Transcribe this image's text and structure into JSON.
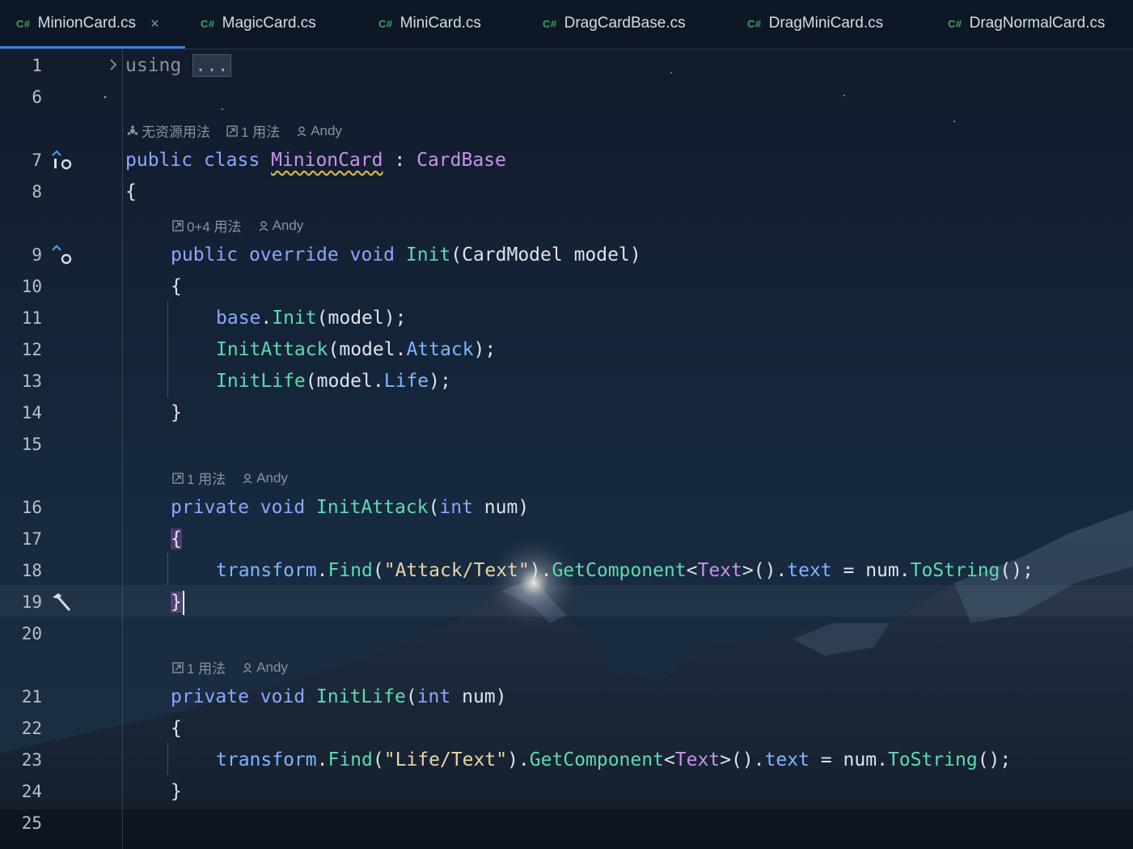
{
  "tabs": [
    {
      "lang": "C#",
      "label": "MinionCard.cs",
      "active": true,
      "closable": true,
      "close": "×"
    },
    {
      "lang": "C#",
      "label": "MagicCard.cs"
    },
    {
      "lang": "C#",
      "label": "MiniCard.cs"
    },
    {
      "lang": "C#",
      "label": "DragCardBase.cs"
    },
    {
      "lang": "C#",
      "label": "DragMiniCard.cs"
    },
    {
      "lang": "C#",
      "label": "DragNormalCard.cs"
    }
  ],
  "hints": {
    "class": {
      "no_asset": "无资源用法",
      "usages": "1 用法",
      "author": "Andy"
    },
    "init": {
      "usages": "0+4 用法",
      "author": "Andy"
    },
    "initattack": {
      "usages": "1 用法",
      "author": "Andy"
    },
    "initlife": {
      "usages": "1 用法",
      "author": "Andy"
    }
  },
  "line_numbers": [
    "1",
    "6",
    "7",
    "8",
    "9",
    "10",
    "11",
    "12",
    "13",
    "14",
    "15",
    "16",
    "17",
    "18",
    "19",
    "20",
    "21",
    "22",
    "23",
    "24",
    "25"
  ],
  "code": {
    "l1_using": "using",
    "l1_fold": "...",
    "public": "public",
    "class": "class",
    "class_name": "MinionCard",
    "colon": " : ",
    "base_class": "CardBase",
    "open": "{",
    "close": "}",
    "override": "override",
    "void": "void",
    "init": "Init",
    "cardmodel": "CardModel",
    "model": "model",
    "base": "base",
    "init_attack": "InitAttack",
    "init_life": "InitLife",
    "attack": "Attack",
    "life": "Life",
    "private": "private",
    "int": "int",
    "num": "num",
    "transform": "transform",
    "find": "Find",
    "attack_path": "\"Attack/Text\"",
    "life_path": "\"Life/Text\"",
    "getcomponent": "GetComponent",
    "text_type": "Text",
    "text_prop": "text",
    "tostring": "ToString"
  },
  "icons": {
    "gutter_class": "implements-up-icon",
    "gutter_init": "override-up-icon",
    "gutter_l19": "hammer-icon"
  }
}
